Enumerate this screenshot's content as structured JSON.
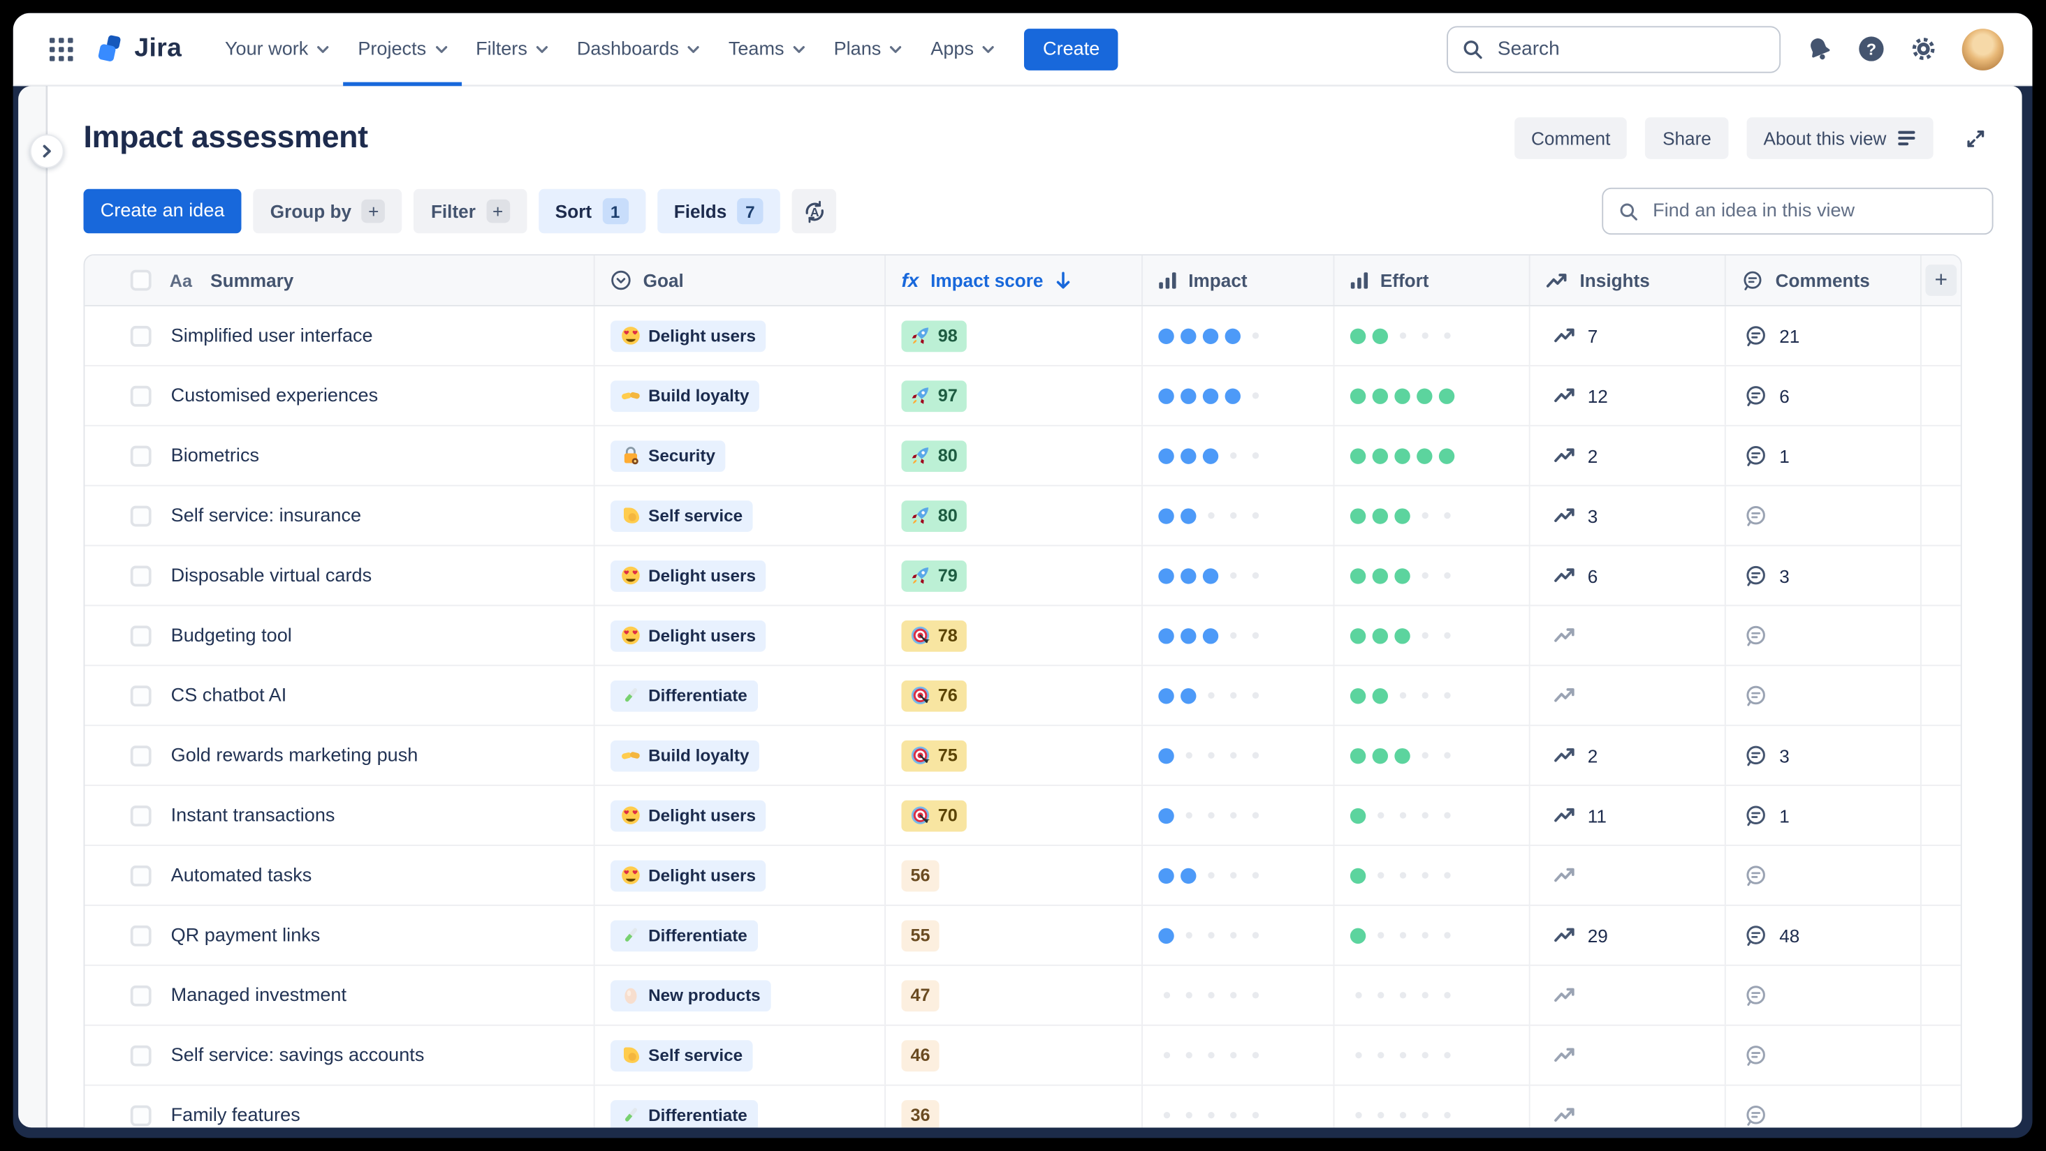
{
  "app": {
    "name": "Jira"
  },
  "nav": {
    "items": [
      {
        "label": "Your work",
        "active": false
      },
      {
        "label": "Projects",
        "active": true
      },
      {
        "label": "Filters",
        "active": false
      },
      {
        "label": "Dashboards",
        "active": false
      },
      {
        "label": "Teams",
        "active": false
      },
      {
        "label": "Plans",
        "active": false
      },
      {
        "label": "Apps",
        "active": false
      }
    ],
    "create_label": "Create",
    "search_placeholder": "Search"
  },
  "header": {
    "title": "Impact assessment",
    "comment_label": "Comment",
    "share_label": "Share",
    "about_label": "About this view"
  },
  "toolbar": {
    "create_idea_label": "Create an idea",
    "group_by_label": "Group by",
    "filter_label": "Filter",
    "sort_label": "Sort",
    "sort_count": "1",
    "fields_label": "Fields",
    "fields_count": "7",
    "find_placeholder": "Find an idea in this view"
  },
  "table": {
    "columns": {
      "summary": "Summary",
      "goal": "Goal",
      "impact_score": "Impact score",
      "impact": "Impact",
      "effort": "Effort",
      "insights": "Insights",
      "comments": "Comments",
      "add_column": "+"
    },
    "rating_max": 5,
    "rows": [
      {
        "summary": "Simplified user interface",
        "goal": {
          "emoji": "heart-eyes",
          "label": "Delight users"
        },
        "score": {
          "value": "98",
          "tier": "high",
          "emoji": "rocket"
        },
        "impact": 4,
        "effort": 2,
        "insights": "7",
        "comments": "21"
      },
      {
        "summary": "Customised experiences",
        "goal": {
          "emoji": "handshake",
          "label": "Build loyalty"
        },
        "score": {
          "value": "97",
          "tier": "high",
          "emoji": "rocket"
        },
        "impact": 4,
        "effort": 5,
        "insights": "12",
        "comments": "6"
      },
      {
        "summary": "Biometrics",
        "goal": {
          "emoji": "locked-with-key",
          "label": "Security"
        },
        "score": {
          "value": "80",
          "tier": "high",
          "emoji": "rocket"
        },
        "impact": 3,
        "effort": 5,
        "insights": "2",
        "comments": "1"
      },
      {
        "summary": "Self service: insurance",
        "goal": {
          "emoji": "flexed-biceps",
          "label": "Self service"
        },
        "score": {
          "value": "80",
          "tier": "high",
          "emoji": "rocket"
        },
        "impact": 2,
        "effort": 3,
        "insights": "3",
        "comments": null
      },
      {
        "summary": "Disposable virtual cards",
        "goal": {
          "emoji": "heart-eyes",
          "label": "Delight users"
        },
        "score": {
          "value": "79",
          "tier": "high",
          "emoji": "rocket"
        },
        "impact": 3,
        "effort": 3,
        "insights": "6",
        "comments": "3"
      },
      {
        "summary": "Budgeting tool",
        "goal": {
          "emoji": "heart-eyes",
          "label": "Delight users"
        },
        "score": {
          "value": "78",
          "tier": "medium",
          "emoji": "target"
        },
        "impact": 3,
        "effort": 3,
        "insights": null,
        "comments": null
      },
      {
        "summary": "CS chatbot AI",
        "goal": {
          "emoji": "test-tube",
          "label": "Differentiate"
        },
        "score": {
          "value": "76",
          "tier": "medium",
          "emoji": "target"
        },
        "impact": 2,
        "effort": 2,
        "insights": null,
        "comments": null
      },
      {
        "summary": "Gold rewards marketing push",
        "goal": {
          "emoji": "handshake",
          "label": "Build loyalty"
        },
        "score": {
          "value": "75",
          "tier": "medium",
          "emoji": "target"
        },
        "impact": 1,
        "effort": 3,
        "insights": "2",
        "comments": "3"
      },
      {
        "summary": "Instant transactions",
        "goal": {
          "emoji": "heart-eyes",
          "label": "Delight users"
        },
        "score": {
          "value": "70",
          "tier": "medium",
          "emoji": "target"
        },
        "impact": 1,
        "effort": 1,
        "insights": "11",
        "comments": "1"
      },
      {
        "summary": "Automated tasks",
        "goal": {
          "emoji": "heart-eyes",
          "label": "Delight users"
        },
        "score": {
          "value": "56",
          "tier": "low",
          "emoji": null
        },
        "impact": 2,
        "effort": 1,
        "insights": null,
        "comments": null
      },
      {
        "summary": "QR payment links",
        "goal": {
          "emoji": "test-tube",
          "label": "Differentiate"
        },
        "score": {
          "value": "55",
          "tier": "low",
          "emoji": null
        },
        "impact": 1,
        "effort": 1,
        "insights": "29",
        "comments": "48"
      },
      {
        "summary": "Managed investment",
        "goal": {
          "emoji": "egg",
          "label": "New products"
        },
        "score": {
          "value": "47",
          "tier": "low",
          "emoji": null
        },
        "impact": 0,
        "effort": 0,
        "insights": null,
        "comments": null
      },
      {
        "summary": "Self service: savings accounts",
        "goal": {
          "emoji": "flexed-biceps",
          "label": "Self service"
        },
        "score": {
          "value": "46",
          "tier": "low",
          "emoji": null
        },
        "impact": 0,
        "effort": 0,
        "insights": null,
        "comments": null
      },
      {
        "summary": "Family features",
        "goal": {
          "emoji": "test-tube",
          "label": "Differentiate"
        },
        "score": {
          "value": "36",
          "tier": "low",
          "emoji": null
        },
        "impact": 0,
        "effort": 0,
        "insights": null,
        "comments": null
      }
    ]
  },
  "colors": {
    "accent_blue": "#1868DB",
    "impact_dot": "#4D9AF8",
    "effort_dot": "#5CD49E",
    "score_high_bg": "#BCF0D5",
    "score_medium_bg": "#F8E5A1",
    "score_low_bg": "#FCEFDF",
    "goal_chip_bg": "#E8F1FE",
    "frame_navy": "#1C2B49"
  }
}
